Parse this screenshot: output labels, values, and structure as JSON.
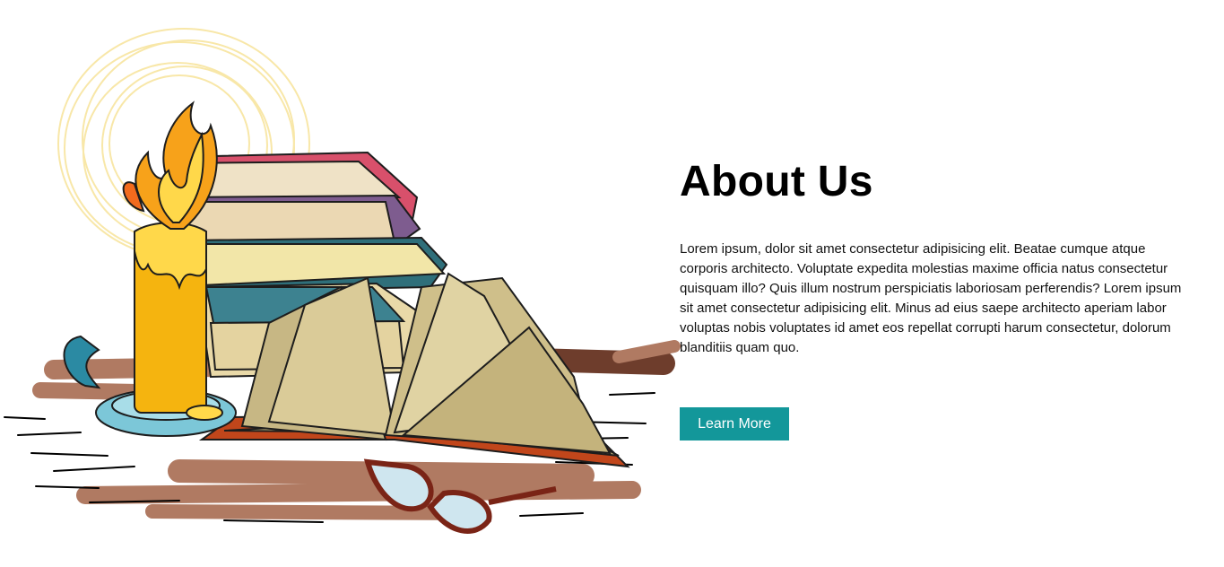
{
  "about": {
    "title": "About Us",
    "paragraph_lines": [
      "Lorem ipsum, dolor sit amet consectetur adipisicing elit. Beatae cumque atque",
      "corporis architecto. Voluptate expedita molestias maxime officia natus consectetur",
      "quisquam illo? Quis illum nostrum perspiciatis laboriosam perferendis? Lorem ipsum",
      "sit amet consectetur adipisicing elit. Minus ad eius saepe architecto aperiam labor",
      "voluptas nobis voluptates id amet eos repellat corrupti harum consectetur, dolorum",
      "blanditiis quam quo."
    ],
    "button_label": "Learn More"
  },
  "colors": {
    "button_bg": "#13979a",
    "button_text": "#ffffff",
    "title": "#000000"
  },
  "illustration": {
    "icons": [
      "candle-icon",
      "book-stack-icon",
      "open-book-icon",
      "glasses-icon"
    ]
  }
}
